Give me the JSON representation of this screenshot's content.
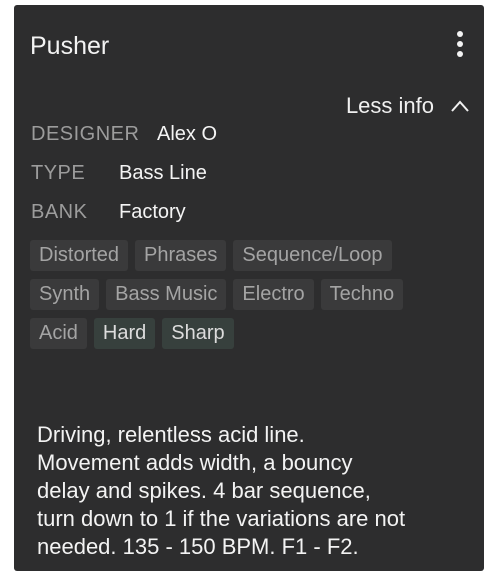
{
  "header": {
    "title": "Pusher",
    "menu_icon": "more-vertical-icon"
  },
  "info_toggle": {
    "label": "Less info",
    "icon": "chevron-up-icon"
  },
  "meta": {
    "designer_label": "DESIGNER",
    "designer_value": "Alex O",
    "type_label": "TYPE",
    "type_value": "Bass Line",
    "bank_label": "BANK",
    "bank_value": "Factory"
  },
  "tags": [
    [
      "Distorted",
      "Phrases",
      "Sequence/Loop"
    ],
    [
      "Synth",
      "Bass Music",
      "Electro",
      "Techno"
    ],
    [
      "Acid",
      "Hard",
      "Sharp"
    ]
  ],
  "active_tags": [
    "Hard",
    "Sharp"
  ],
  "description": {
    "lines": [
      "Driving, relentless acid line.",
      "Movement adds width, a bouncy",
      "delay and spikes. 4 bar sequence,",
      "turn down to 1 if the variations are not",
      "needed. 135 - 150 BPM. F1 - F2."
    ]
  },
  "colors": {
    "panel_bg": "#2d2d2e",
    "tag_bg": "#3a3a3b",
    "tag_active_bg": "#37403d",
    "label_gray": "#9c9c9c"
  }
}
